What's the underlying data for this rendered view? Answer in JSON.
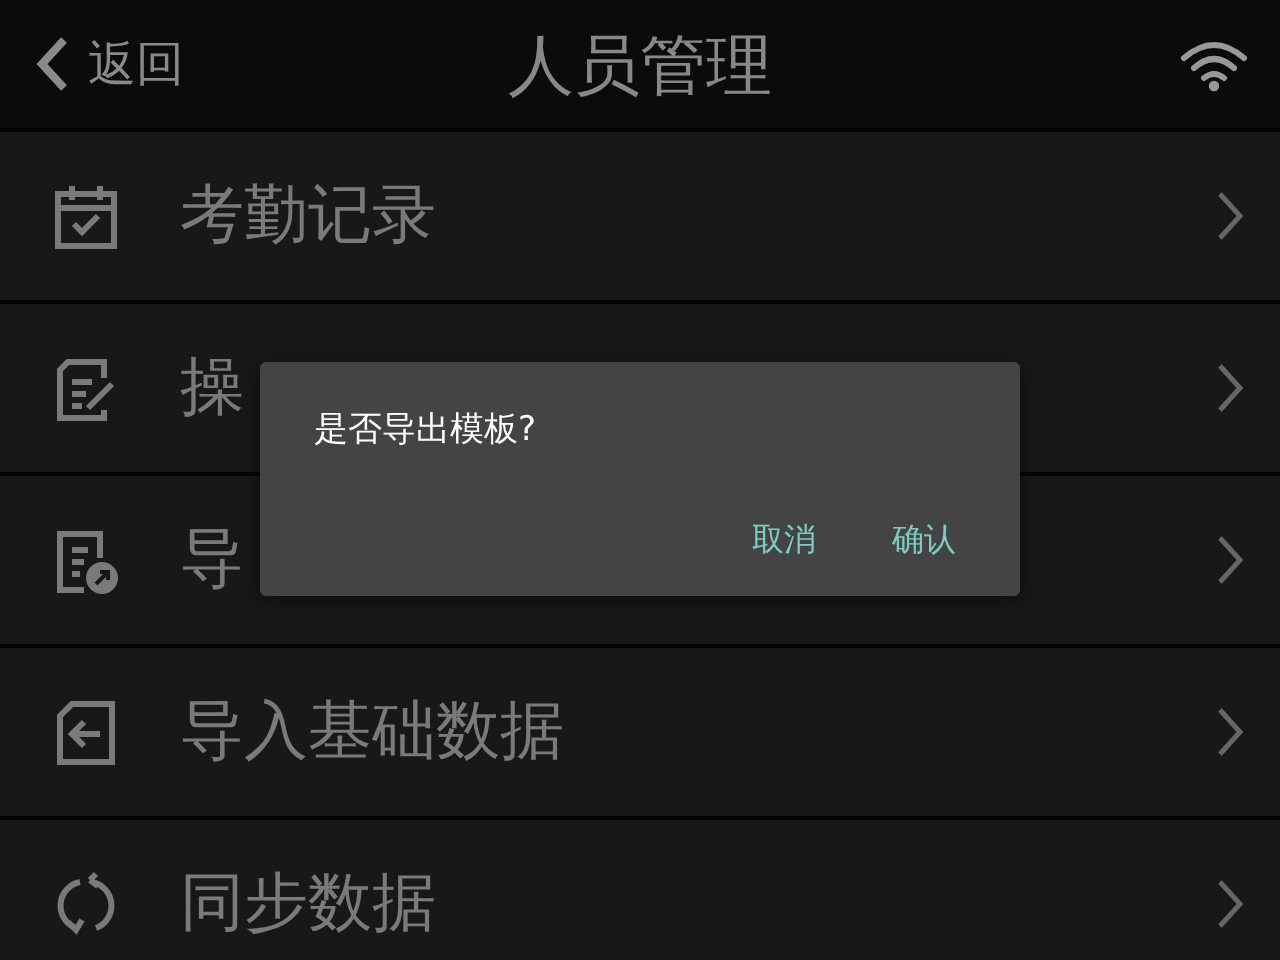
{
  "header": {
    "back_label": "返回",
    "title": "人员管理"
  },
  "menu_items": [
    {
      "label": "考勤记录"
    },
    {
      "label": "操"
    },
    {
      "label": "导"
    },
    {
      "label": "导入基础数据"
    },
    {
      "label": "同步数据"
    }
  ],
  "dialog": {
    "message": "是否导出模板?",
    "buttons": [
      "取消",
      "确认"
    ]
  }
}
